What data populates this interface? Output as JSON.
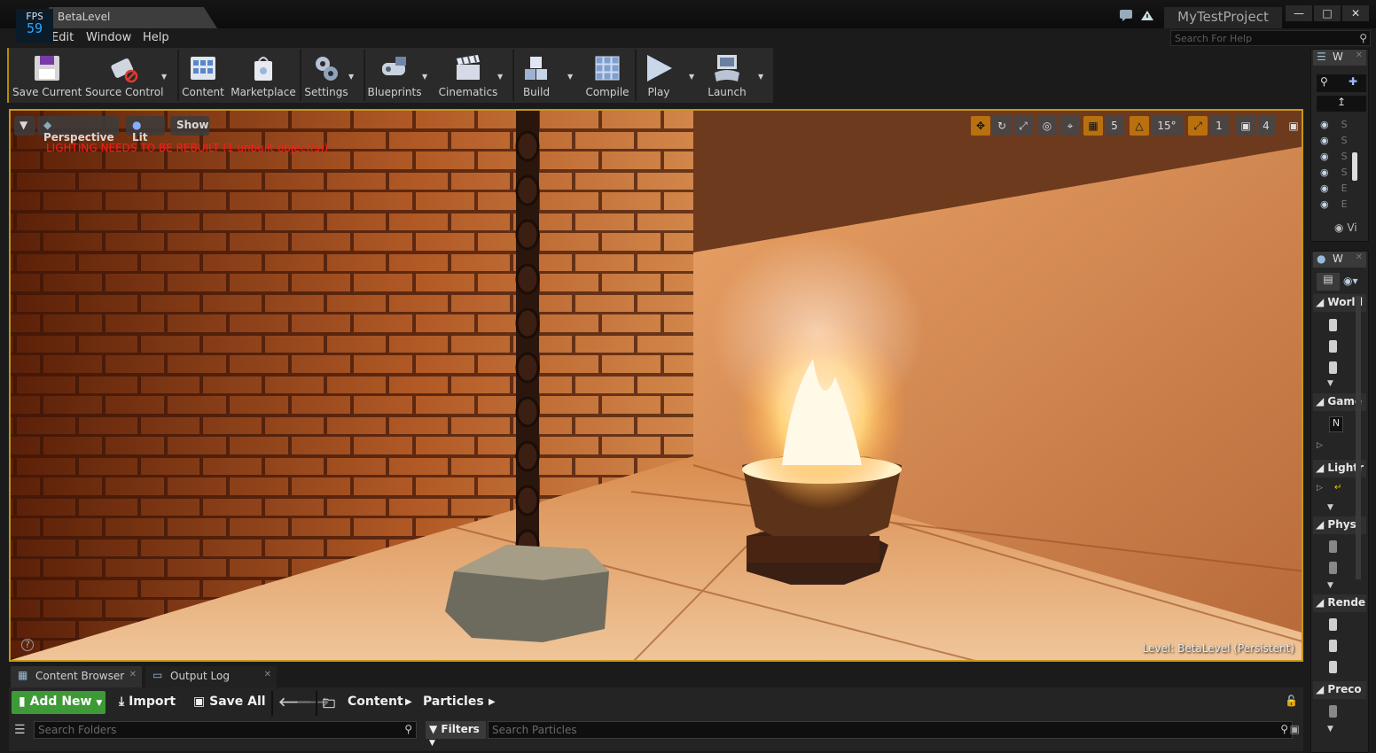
{
  "window": {
    "tab_title": "BetaLevel",
    "project_title": "MyTestProject",
    "fps_label": "FPS",
    "fps_value": "59",
    "controls": [
      "—",
      "□",
      "✕"
    ]
  },
  "menu": {
    "items": [
      "Edit",
      "Window",
      "Help"
    ],
    "search_placeholder": "Search For Help"
  },
  "toolbar": {
    "buttons": [
      {
        "label": "Save Current",
        "icon": "floppy-disk-icon"
      },
      {
        "label": "Source Control",
        "icon": "source-control-icon"
      },
      {
        "label": "Content",
        "icon": "content-grid-icon"
      },
      {
        "label": "Marketplace",
        "icon": "marketplace-bag-icon"
      },
      {
        "label": "Settings",
        "icon": "gears-icon"
      },
      {
        "label": "Blueprints",
        "icon": "blueprints-icon"
      },
      {
        "label": "Cinematics",
        "icon": "clapperboard-icon"
      },
      {
        "label": "Build",
        "icon": "build-blocks-icon"
      },
      {
        "label": "Compile",
        "icon": "compile-cubes-icon"
      },
      {
        "label": "Play",
        "icon": "play-triangle-icon"
      },
      {
        "label": "Launch",
        "icon": "launch-gamepad-icon"
      }
    ]
  },
  "viewport": {
    "view_mode": "Perspective",
    "lighting_mode": "Lit",
    "show_label": "Show",
    "warning": "LIGHTING NEEDS TO BE REBUILT (1 unbuilt object(s))",
    "grid_snap": "5",
    "rotation_snap": "15°",
    "scale_snap": "1",
    "camera_speed": "4",
    "level_label": "Level:  BetaLevel (Persistent)"
  },
  "outliner": {
    "tab": "W",
    "rows": [
      "S",
      "S",
      "S",
      "S",
      "E",
      "E"
    ],
    "view_options": "Vi"
  },
  "details": {
    "tab": "W",
    "categories": [
      "World",
      "Game",
      "Lightr",
      "Physi",
      "Rende",
      "Preco"
    ],
    "game_field": "N"
  },
  "bottom_tabs": [
    "Content Browser",
    "Output Log"
  ],
  "content_browser": {
    "add_new": "Add New",
    "import": "Import",
    "save_all": "Save All",
    "breadcrumb": [
      "Content",
      "Particles"
    ],
    "search_folders": "Search Folders",
    "filters": "Filters",
    "search_assets": "Search Particles"
  },
  "colors": {
    "accent": "#c79519",
    "add_new_green": "#3d9a36",
    "warning_red": "#ff1a1a",
    "fps_blue": "#2ea8ff"
  }
}
